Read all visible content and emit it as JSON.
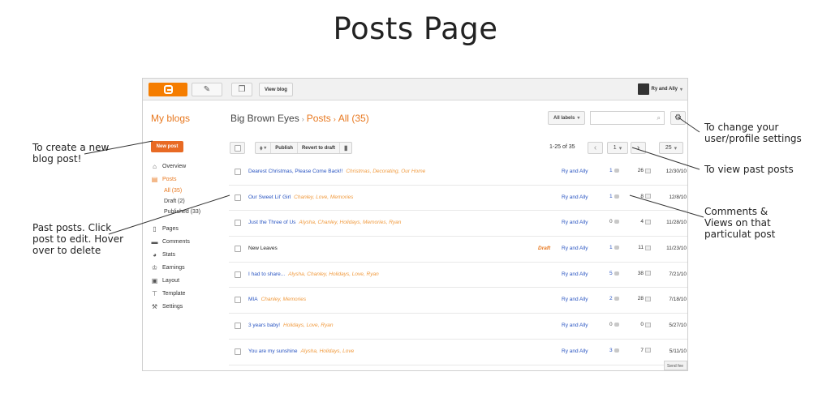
{
  "page_title": "Posts Page",
  "topbar": {
    "view_blog_label": "View blog",
    "user_name": "Ry and Ally",
    "user_caret": "▾"
  },
  "header": {
    "my_blogs": "My blogs",
    "blog_name": "Big Brown Eyes",
    "crumb_posts": "Posts",
    "crumb_all": "All (35)",
    "labels_button": "All labels",
    "caret": "▾"
  },
  "sidebar": {
    "new_post": "New post",
    "overview": "Overview",
    "posts": "Posts",
    "sub_all": "All (35)",
    "sub_draft": "Draft (2)",
    "sub_published": "Published (33)",
    "pages": "Pages",
    "comments": "Comments",
    "stats": "Stats",
    "earnings": "Earnings",
    "layout": "Layout",
    "template": "Template",
    "settings": "Settings"
  },
  "toolbar": {
    "caret": "▾",
    "publish": "Publish",
    "revert": "Revert to draft",
    "range": "1-25 of 35",
    "page": "1",
    "prev": "‹",
    "next": "›",
    "per_page": "25"
  },
  "rows": [
    {
      "title": "Dearest Christmas, Please Come Back!!",
      "labels": "Christmas, Decorating, Our Home",
      "draft": "",
      "author": "Ry and Ally",
      "comments": "1",
      "views": "26",
      "date": "12/30/10"
    },
    {
      "title": "Our Sweet Lil' Girl",
      "labels": "Chanley, Love, Memories",
      "draft": "",
      "author": "Ry and Ally",
      "comments": "1",
      "views": "8",
      "date": "12/8/10"
    },
    {
      "title": "Just the Three of Us",
      "labels": "Alysha, Chanley, Holidays, Memories, Ryan",
      "draft": "",
      "author": "Ry and Ally",
      "comments": "0",
      "views": "4",
      "date": "11/28/10"
    },
    {
      "title": "New Leaves",
      "labels": "",
      "draft": "Draft",
      "author": "Ry and Ally",
      "comments": "1",
      "views": "11",
      "date": "11/23/10"
    },
    {
      "title": "I had to share...",
      "labels": "Alysha, Chanley, Holidays, Love, Ryan",
      "draft": "",
      "author": "Ry and Ally",
      "comments": "5",
      "views": "38",
      "date": "7/21/10"
    },
    {
      "title": "MIA",
      "labels": "Chanley, Memories",
      "draft": "",
      "author": "Ry and Ally",
      "comments": "2",
      "views": "28",
      "date": "7/18/10"
    },
    {
      "title": "3 years baby!",
      "labels": "Holidays, Love, Ryan",
      "draft": "",
      "author": "Ry and Ally",
      "comments": "0",
      "views": "0",
      "date": "5/27/10"
    },
    {
      "title": "You are my sunshine",
      "labels": "Alysha, Holidays, Love",
      "draft": "",
      "author": "Ry and Ally",
      "comments": "3",
      "views": "7",
      "date": "5/11/10"
    }
  ],
  "send_feedback": "Send fee",
  "annotations": {
    "new_post": [
      "To create a new",
      "blog post!"
    ],
    "past_posts": [
      "Past posts. Click",
      "post to edit. Hover",
      "over to delete"
    ],
    "profile": [
      "To change your",
      "user/profile settings"
    ],
    "past_pages": [
      "To view past posts"
    ],
    "comments_views": [
      "Comments &",
      "Views on that",
      "particulat post"
    ]
  },
  "colors": {
    "accent_orange": "#e8781f",
    "link_blue": "#2a55c2",
    "blogger_orange": "#f57d00"
  }
}
